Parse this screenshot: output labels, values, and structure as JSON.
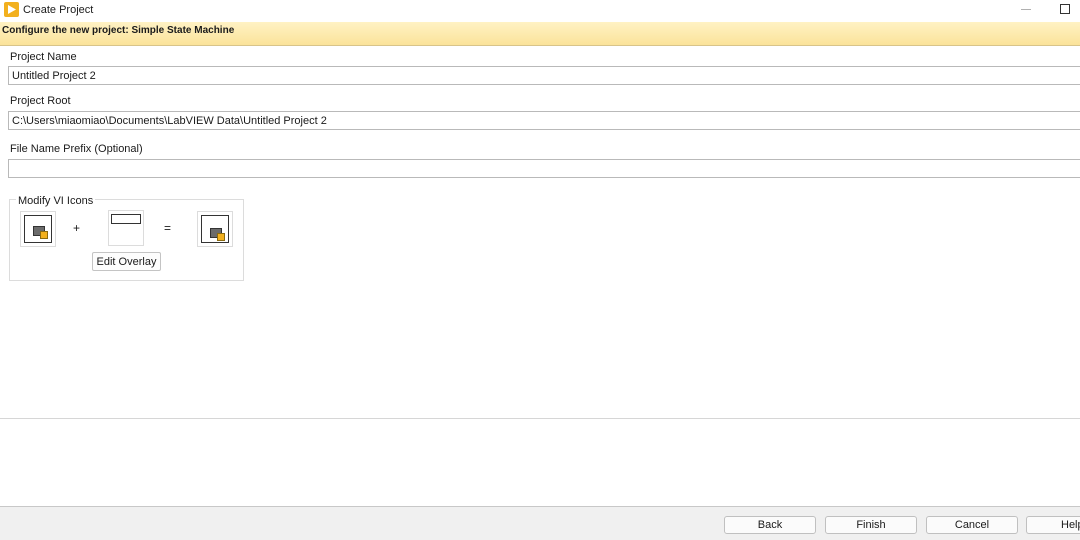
{
  "window": {
    "title": "Create Project",
    "icon": "labview-play-icon"
  },
  "banner": {
    "text": "Configure the new project: Simple State Machine"
  },
  "fields": {
    "project_name": {
      "label": "Project Name",
      "value": "Untitled Project 2"
    },
    "project_root": {
      "label": "Project Root",
      "value": "C:\\Users\\miaomiao\\Documents\\LabVIEW Data\\Untitled Project 2"
    },
    "file_prefix": {
      "label": "File Name Prefix (Optional)",
      "value": ""
    }
  },
  "icons_group": {
    "legend": "Modify VI Icons",
    "plus": "+",
    "equals": "=",
    "edit_overlay_label": "Edit Overlay"
  },
  "footer": {
    "back_label": "Back",
    "finish_label": "Finish",
    "cancel_label": "Cancel",
    "help_label": "Help"
  },
  "colors": {
    "banner_top": "#fff2c4",
    "banner_bottom": "#fbe39a",
    "app_icon": "#f2b01e"
  }
}
